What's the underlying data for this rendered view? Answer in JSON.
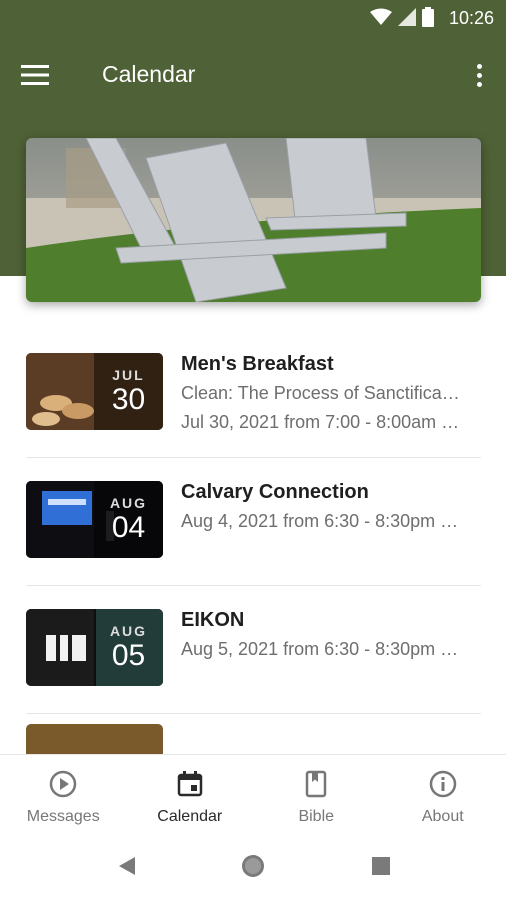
{
  "status": {
    "time": "10:26"
  },
  "header": {
    "title": "Calendar",
    "menu_icon": "hamburger-icon",
    "overflow_icon": "more-vert-icon"
  },
  "colors": {
    "header_bg": "#4f6136",
    "active": "#2a2a2a",
    "inactive": "#777777"
  },
  "events": [
    {
      "title": "Men's Breakfast",
      "line1": "Clean: The Process of Sanctifica…",
      "line2": "Jul 30, 2021 from 7:00 - 8:00am …",
      "month": "JUL",
      "day": "30"
    },
    {
      "title": "Calvary Connection",
      "line1": "Aug 4, 2021 from 6:30 - 8:30pm …",
      "month": "AUG",
      "day": "04"
    },
    {
      "title": "EIKON",
      "line1": "Aug 5, 2021 from 6:30 - 8:30pm …",
      "month": "AUG",
      "day": "05"
    }
  ],
  "nav": {
    "messages": "Messages",
    "calendar": "Calendar",
    "bible": "Bible",
    "about": "About"
  }
}
